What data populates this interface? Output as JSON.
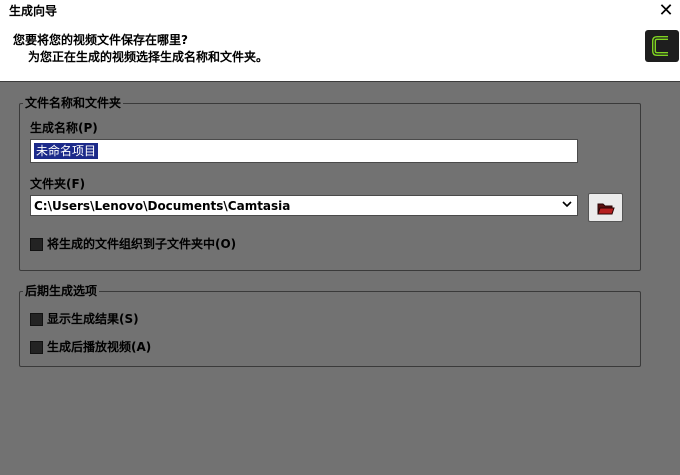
{
  "window": {
    "title": "生成向导",
    "close_glyph": "✕"
  },
  "header": {
    "heading": "您要将您的视频文件保存在哪里?",
    "subheading": "为您正在生成的视频选择生成名称和文件夹。",
    "logo_icon": "camtasia-logo-icon",
    "logo_color": "#7fd321"
  },
  "name_folder_group": {
    "legend": "文件名称和文件夹",
    "production_name_label": "生成名称(P)",
    "production_name_value": "未命名项目",
    "folder_label": "文件夹(F)",
    "folder_value": "C:\\Users\\Lenovo\\Documents\\Camtasia",
    "folder_dropdown_icon": "chevron-down-icon",
    "browse_icon": "folder-open-icon",
    "organize_checkbox_label": "将生成的文件组织到子文件夹中(O)",
    "organize_checked": false
  },
  "post_production_group": {
    "legend": "后期生成选项",
    "show_results_label": "显示生成结果(S)",
    "show_results_checked": false,
    "play_after_label": "生成后播放视频(A)",
    "play_after_checked": false
  },
  "colors": {
    "background": "#727272",
    "selection": "#1c2a8a"
  }
}
